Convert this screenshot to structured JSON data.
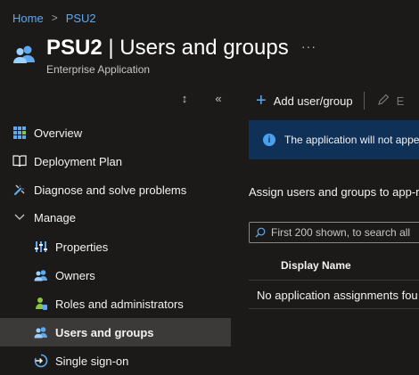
{
  "breadcrumb": {
    "home": "Home",
    "current": "PSU2"
  },
  "header": {
    "title": "PSU2",
    "title_suffix": " | Users and groups",
    "subtitle": "Enterprise Application",
    "more": "···",
    "icon": "users-group-icon"
  },
  "sidebar": {
    "controls": {
      "expand": "↕",
      "collapse": "«"
    },
    "items": [
      {
        "label": "Overview",
        "icon": "overview-grid-icon"
      },
      {
        "label": "Deployment Plan",
        "icon": "book-icon"
      },
      {
        "label": "Diagnose and solve problems",
        "icon": "wrench-icon"
      },
      {
        "label": "Manage",
        "icon": "chevron-down-icon"
      },
      {
        "label": "Properties",
        "icon": "properties-sliders-icon"
      },
      {
        "label": "Owners",
        "icon": "owners-icon"
      },
      {
        "label": "Roles and administrators",
        "icon": "roles-icon"
      },
      {
        "label": "Users and groups",
        "icon": "users-groups-icon",
        "active": true
      },
      {
        "label": "Single sign-on",
        "icon": "sso-icon"
      }
    ]
  },
  "toolbar": {
    "add_label": "Add user/group",
    "edit_label": "E"
  },
  "banner": {
    "text": "The application will not appe"
  },
  "main": {
    "assign_text": "Assign users and groups to app-r",
    "search_placeholder": "First 200 shown, to search all",
    "table_header": "Display Name",
    "empty_text": "No application assignments fou"
  },
  "colors": {
    "background": "#1b1a19",
    "accent": "#5ea9f0",
    "active_item": "#3b3a39",
    "banner": "#0f3057"
  }
}
